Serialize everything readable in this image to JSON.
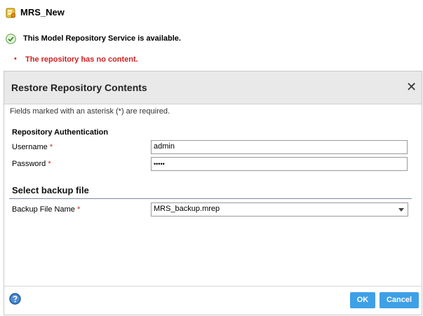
{
  "service": {
    "name": "MRS_New",
    "availability": "This Model Repository Service is available.",
    "bullet": "•",
    "error": "The repository has no content."
  },
  "dialog": {
    "title": "Restore Repository Contents",
    "close_glyph": "✕",
    "required_note": "Fields marked with an asterisk (*) are required.",
    "auth_section": "Repository Authentication",
    "username_label": "Username",
    "username_value": "admin",
    "password_label": "Password",
    "password_value": "•••••",
    "required_mark": "*",
    "backup_section": "Select backup file",
    "backup_label": "Backup File Name",
    "backup_value": "MRS_backup.mrep",
    "ok_label": "OK",
    "cancel_label": "Cancel"
  },
  "colors": {
    "error_red": "#d11f1f",
    "button_blue": "#3ea0e6",
    "titlebar_gray": "#e9e9e9"
  },
  "icons": {
    "service": "database-service-icon",
    "available": "check-circle-icon",
    "close": "close-icon",
    "help": "help-icon"
  }
}
